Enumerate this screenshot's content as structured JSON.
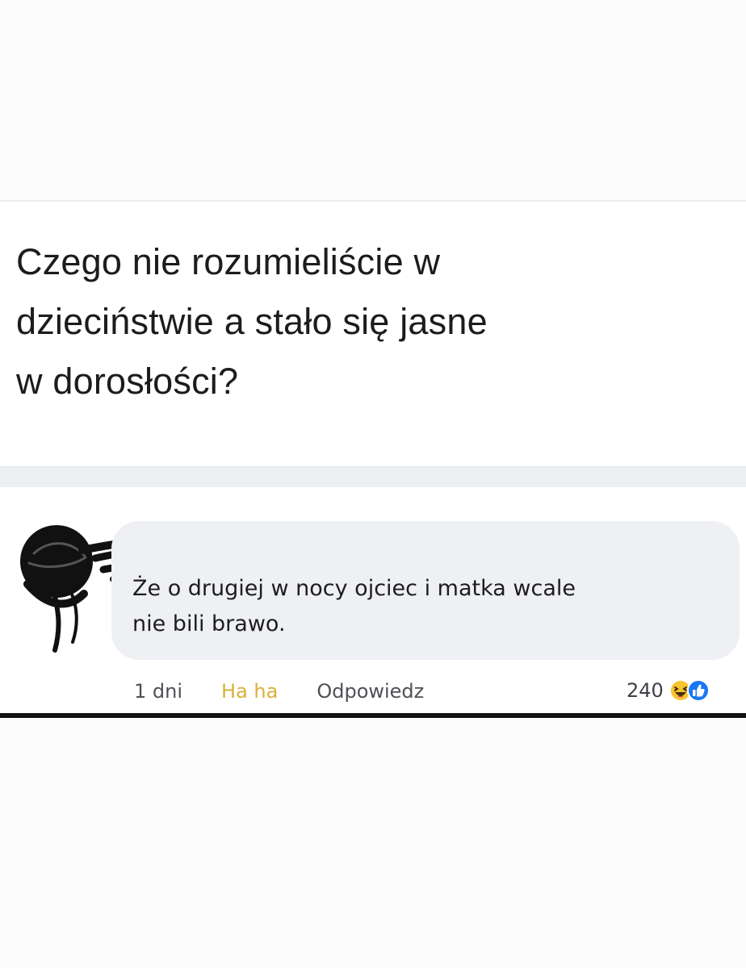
{
  "post": {
    "text": "Czego nie rozumieliście w\ndzieciństwie a stało się jasne\nw dorosłości?"
  },
  "comment": {
    "text": "Że o drugiej w nocy ojciec i matka wcale\nnie bili brawo.",
    "time": "1 dni",
    "reaction_label": "Ha ha",
    "reply_label": "Odpowiedz",
    "reaction_count": "240",
    "reaction_icons": [
      "haha-icon",
      "like-icon"
    ]
  },
  "colors": {
    "bubble": "#eef0f4",
    "reaction_label": "#d7b13a",
    "like_blue": "#1877f2",
    "haha_yellow": "#f7c531"
  }
}
